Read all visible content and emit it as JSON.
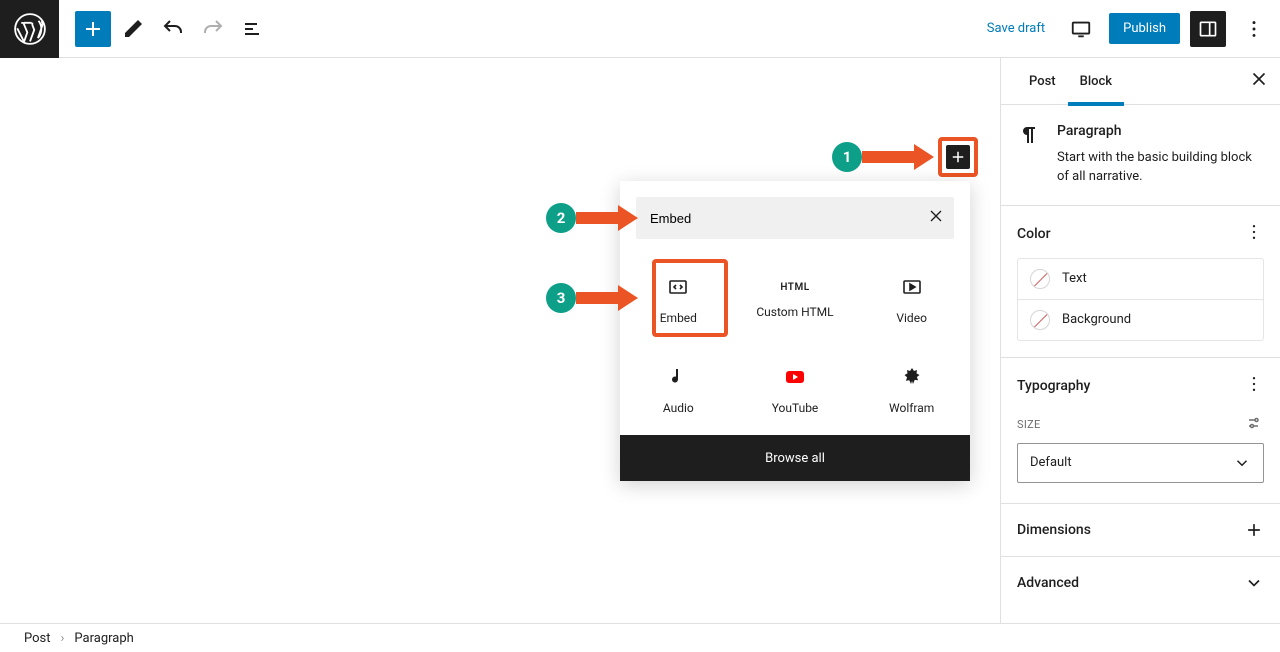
{
  "topbar": {
    "save_draft": "Save draft",
    "publish": "Publish"
  },
  "sidebar": {
    "tabs": {
      "post": "Post",
      "block": "Block"
    },
    "block_title": "Paragraph",
    "block_desc": "Start with the basic building block of all narrative.",
    "color": {
      "title": "Color",
      "text": "Text",
      "background": "Background"
    },
    "typo": {
      "title": "Typography",
      "size_label": "SIZE",
      "size_value": "Default"
    },
    "dimensions": "Dimensions",
    "advanced": "Advanced"
  },
  "inserter": {
    "search_value": "Embed",
    "items": [
      {
        "label": "Embed",
        "icon": "embed"
      },
      {
        "label": "Custom HTML",
        "icon": "html"
      },
      {
        "label": "Video",
        "icon": "video"
      },
      {
        "label": "Audio",
        "icon": "audio"
      },
      {
        "label": "YouTube",
        "icon": "youtube"
      },
      {
        "label": "Wolfram",
        "icon": "wolfram"
      }
    ],
    "browse": "Browse all"
  },
  "footer": {
    "crumb1": "Post",
    "crumb2": "Paragraph"
  },
  "annotations": {
    "s1": "1",
    "s2": "2",
    "s3": "3"
  }
}
